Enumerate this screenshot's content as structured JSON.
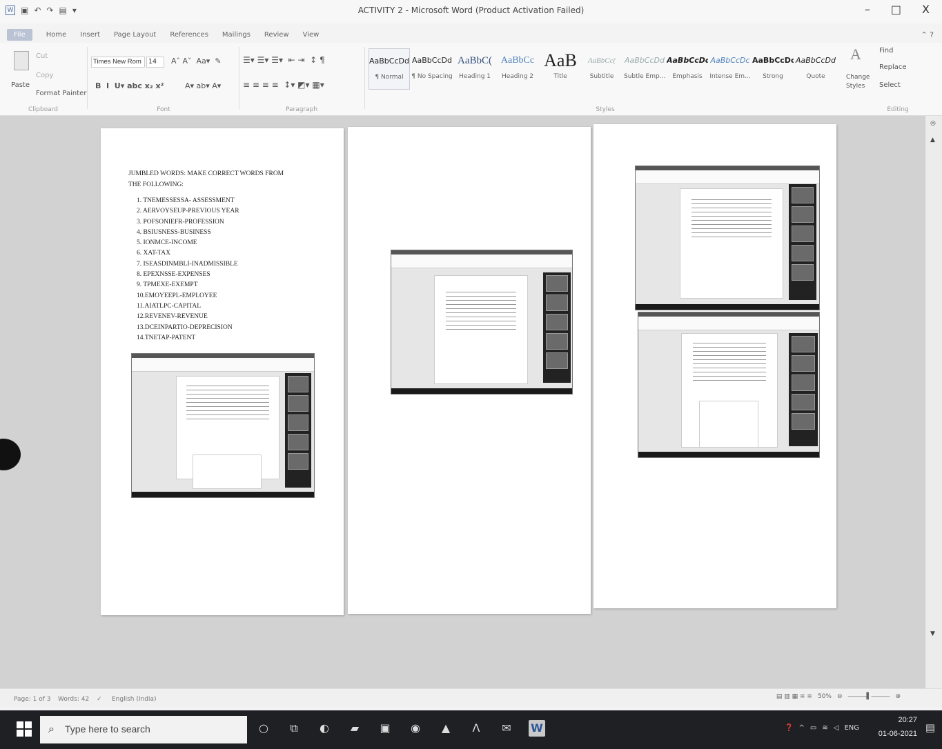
{
  "window": {
    "title": "ACTIVITY 2 - Microsoft Word (Product Activation Failed)",
    "minimize": "–",
    "restore": "□",
    "close": "X"
  },
  "ribbon": {
    "tabs": [
      "File",
      "Home",
      "Insert",
      "Page Layout",
      "References",
      "Mailings",
      "Review",
      "View"
    ],
    "clipboard": {
      "paste": "Paste",
      "cut": "Cut",
      "copy": "Copy",
      "format_painter": "Format Painter",
      "label": "Clipboard"
    },
    "font": {
      "name": "Times New Rom",
      "size": "14",
      "label": "Font"
    },
    "paragraph": {
      "label": "Paragraph"
    },
    "styles": {
      "label": "Styles",
      "items": [
        {
          "preview": "AaBbCcDd",
          "name": "¶ Normal"
        },
        {
          "preview": "AaBbCcDd",
          "name": "¶ No Spacing"
        },
        {
          "preview": "AaBbC(",
          "name": "Heading 1"
        },
        {
          "preview": "AaBbCc",
          "name": "Heading 2"
        },
        {
          "preview": "AaB",
          "name": "Title"
        },
        {
          "preview": "AaBbCc(",
          "name": "Subtitle"
        },
        {
          "preview": "AaBbCcDd",
          "name": "Subtle Emp..."
        },
        {
          "preview": "AaBbCcDd",
          "name": "Emphasis"
        },
        {
          "preview": "AaBbCcDc",
          "name": "Intense Em..."
        },
        {
          "preview": "AaBbCcDc",
          "name": "Strong"
        },
        {
          "preview": "AaBbCcDd",
          "name": "Quote"
        }
      ],
      "change_styles": "Change Styles"
    },
    "editing": {
      "find": "Find",
      "replace": "Replace",
      "select": "Select",
      "label": "Editing"
    }
  },
  "document": {
    "heading": "JUMBLED WORDS: MAKE CORRECT WORDS FROM THE FOLLOWING:",
    "items": [
      "1. TNEMESSESSA- ASSESSMENT",
      "2. AERVOYSEUP-PREVIOUS YEAR",
      "3. POFSONIEFR-PROFESSION",
      "4. BSIUSNESS-BUSINESS",
      "5. IONMCE-INCOME",
      "6. XAT-TAX",
      "7. ISEASDINMBLI-INADMISSIBLE",
      "8. EPEXNSSE-EXPENSES",
      "9. TPMEXE-EXEMPT",
      "10.EMOYEEPL-EMPLOYEE",
      "11.AIATLPC-CAPITAL",
      "12.REVENEV-REVENUE",
      "13.DCEINPARTIO-DEPRECISION",
      "14.TNETAP-PATENT"
    ]
  },
  "status": {
    "page": "Page: 1 of 3",
    "words": "Words: 42",
    "language": "English (India)",
    "zoom": "50%"
  },
  "taskbar": {
    "search_placeholder": "Type here to search",
    "lang": "ENG",
    "time": "20:27",
    "date": "01-06-2021"
  },
  "icons": [
    "word-logo-icon",
    "save-icon",
    "undo-icon",
    "print-icon",
    "search-icon",
    "windows-start-icon",
    "word-taskbar-icon",
    "notification-icon"
  ]
}
